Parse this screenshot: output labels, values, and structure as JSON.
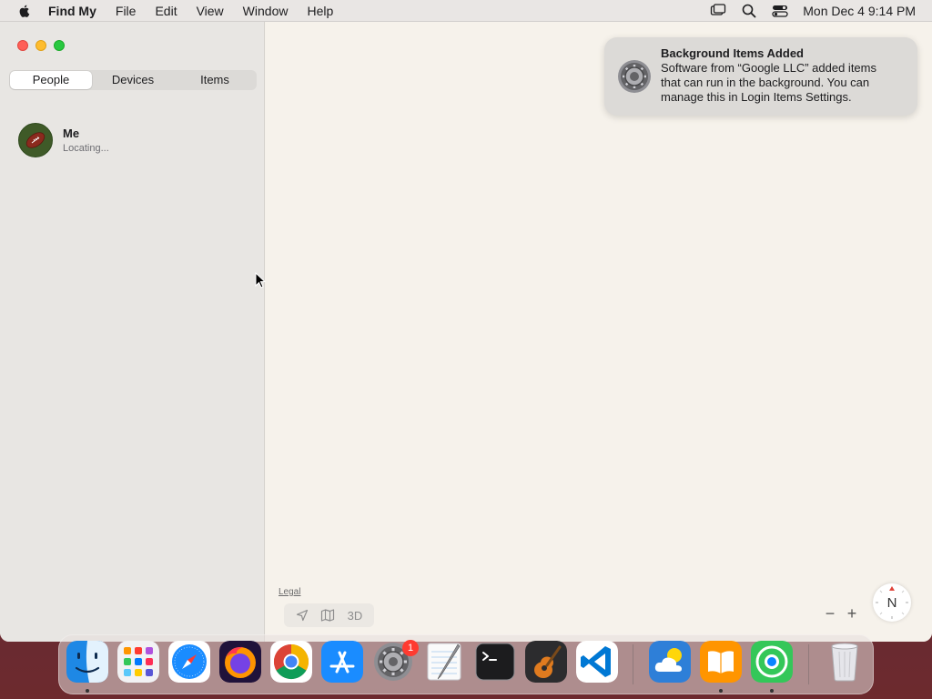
{
  "menubar": {
    "app_name": "Find My",
    "items": [
      "File",
      "Edit",
      "View",
      "Window",
      "Help"
    ],
    "clock": "Mon Dec 4  9:14 PM"
  },
  "sidebar": {
    "tabs": [
      "People",
      "Devices",
      "Items"
    ],
    "active_tab": "People",
    "people": [
      {
        "name": "Me",
        "status": "Locating..."
      }
    ]
  },
  "map": {
    "legal_label": "Legal",
    "view_3d_label": "3D",
    "zoom_out_label": "−",
    "zoom_in_label": "+",
    "compass_label": "N"
  },
  "notification": {
    "title": "Background Items Added",
    "body": "Software from “Google LLC” added items that can run in the background. You can manage this in Login Items Settings."
  },
  "dock": {
    "settings_badge": "1",
    "apps": [
      "finder",
      "launchpad",
      "safari",
      "firefox",
      "chrome",
      "app-store",
      "system-settings",
      "textedit",
      "terminal",
      "garageband",
      "vscode",
      "weather",
      "books",
      "find-my",
      "trash"
    ]
  },
  "colors": {
    "menubar_bg": "#e9e6e4",
    "sidebar_bg": "#e8e6e3",
    "map_bg": "#f6f2eb",
    "close": "#ff5f57",
    "minimize": "#febc2e",
    "maximize": "#28c840",
    "badge": "#ff3b30"
  }
}
